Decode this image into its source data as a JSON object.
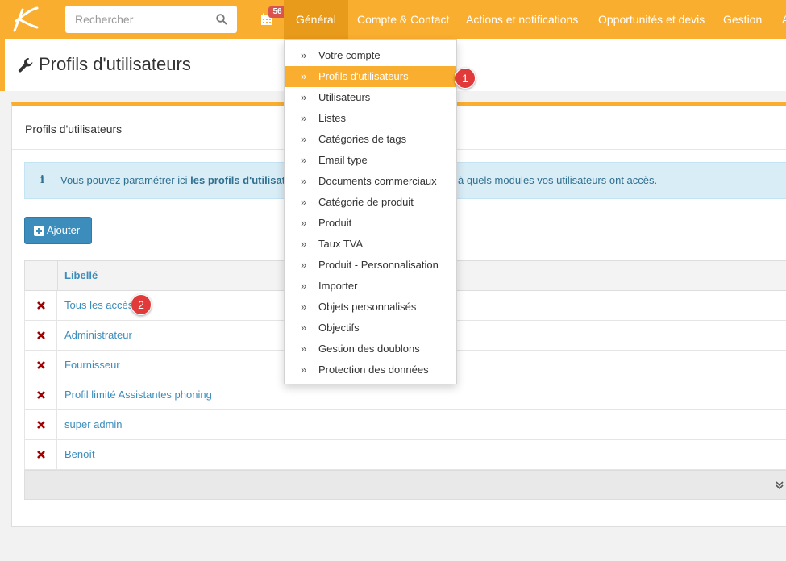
{
  "nav": {
    "search_placeholder": "Rechercher",
    "calendar_badge": "56",
    "items": [
      "Général",
      "Compte & Contact",
      "Actions et notifications",
      "Opportunités et devis",
      "Gestion",
      "A"
    ]
  },
  "page": {
    "title": "Profils d'utilisateurs"
  },
  "panel": {
    "title": "Profils d'utilisateurs",
    "info_prefix": "Vous pouvez paramétrer ici ",
    "info_bold": "les profils d'utilisat",
    "info_tail": "à quels modules vos utilisateurs ont accès.",
    "add_label": "Ajouter"
  },
  "table": {
    "header": "Libellé",
    "rows": [
      "Tous les accès",
      "Administrateur",
      "Fournisseur",
      "Profil limité Assistantes phoning",
      "super admin",
      "Benoît"
    ]
  },
  "dropdown": {
    "items": [
      "Votre compte",
      "Profils d'utilisateurs",
      "Utilisateurs",
      "Listes",
      "Catégories de tags",
      "Email type",
      "Documents commerciaux",
      "Catégorie de produit",
      "Produit",
      "Taux TVA",
      "Produit - Personnalisation",
      "Importer",
      "Objets personnalisés",
      "Objectifs",
      "Gestion des doublons",
      "Protection des données"
    ],
    "active_index": 1
  },
  "markers": [
    "1",
    "2"
  ],
  "colors": {
    "brand": "#f9ae2f",
    "link": "#3c8dbc",
    "danger": "#a00000"
  }
}
